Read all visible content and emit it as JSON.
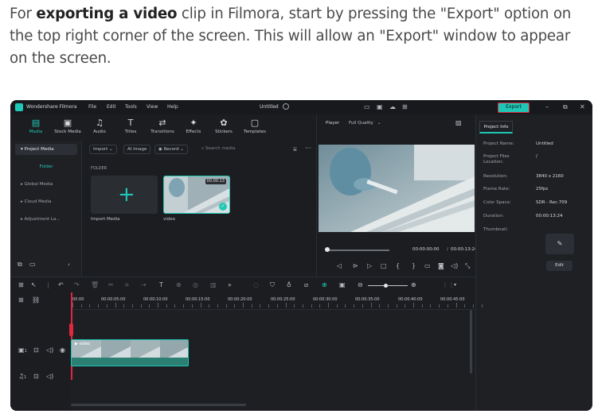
{
  "article": {
    "pre": "For ",
    "bold": "exporting a video",
    "post": " clip in Filmora, start by pressing the \"Export\" option on the top right corner of the screen. This will allow an \"Export\" window to appear on the screen."
  },
  "titlebar": {
    "app_name": "Wondershare Filmora",
    "menu": [
      "File",
      "Edit",
      "Tools",
      "View",
      "Help"
    ],
    "project_title": "Untitled",
    "export_label": "Export"
  },
  "toolbar": {
    "tools": [
      {
        "label": "Media",
        "icon": "media-icon"
      },
      {
        "label": "Stock Media",
        "icon": "stock-media-icon"
      },
      {
        "label": "Audio",
        "icon": "music-note-icon"
      },
      {
        "label": "Titles",
        "icon": "titles-icon"
      },
      {
        "label": "Transitions",
        "icon": "transitions-icon"
      },
      {
        "label": "Effects",
        "icon": "effects-icon"
      },
      {
        "label": "Stickers",
        "icon": "stickers-icon"
      },
      {
        "label": "Templates",
        "icon": "templates-icon"
      }
    ]
  },
  "sidebar": {
    "items": [
      "Project Media",
      "Folder",
      "Global Media",
      "Cloud Media",
      "Adjustment La..."
    ]
  },
  "media": {
    "import_label": "Import",
    "ai_image_label": "AI Image",
    "record_label": "Record",
    "search_placeholder": "Search media",
    "folder_header": "FOLDER",
    "import_media_label": "Import Media",
    "video_label": "video",
    "video_duration": "00:00:13"
  },
  "player": {
    "label": "Player",
    "quality": "Full Quality",
    "current_time": "00:00:00:00",
    "separator": "/",
    "total_time": "00:00:13:24"
  },
  "project_info": {
    "tab_label": "Project Info",
    "rows": [
      {
        "key": "Project Name:",
        "value": "Untitled"
      },
      {
        "key": "Project Files Location:",
        "value": "/"
      },
      {
        "key": "Resolution:",
        "value": "3840 x 2160"
      },
      {
        "key": "Frame Rate:",
        "value": "25fps"
      },
      {
        "key": "Color Space:",
        "value": "SDR - Rec.709"
      },
      {
        "key": "Duration:",
        "value": "00:00:13:24"
      },
      {
        "key": "Thumbnail:",
        "value": ""
      }
    ],
    "edit_label": "Edit"
  },
  "timeline": {
    "ruler_labels": [
      "00:00",
      "00:00:05:00",
      "00:00:10:00",
      "00:00:15:00",
      "00:00:20:00",
      "00:00:25:00",
      "00:00:30:00",
      "00:00:35:00",
      "00:00:40:00",
      "00:00:45:00"
    ],
    "clip_label": "video",
    "video_track_number": "1",
    "audio_track_number": "1"
  },
  "colors": {
    "accent": "#1fc7b6",
    "highlight_border": "#e0273b",
    "background": "#1b1d21"
  }
}
